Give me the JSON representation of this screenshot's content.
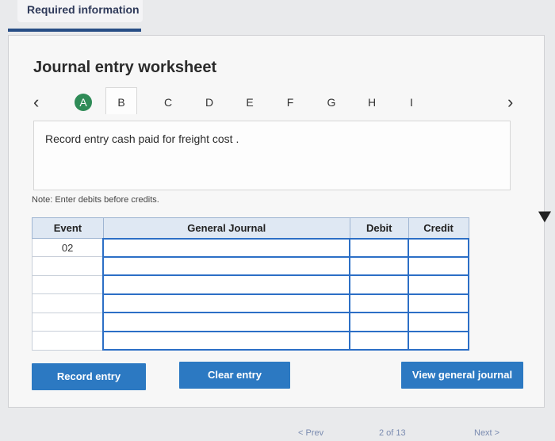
{
  "header": {
    "tab_label": "Required information"
  },
  "worksheet": {
    "title": "Journal entry worksheet",
    "nav": {
      "prev_icon": "chevron-left-icon",
      "next_icon": "chevron-right-icon",
      "steps": [
        "A",
        "B",
        "C",
        "D",
        "E",
        "F",
        "G",
        "H",
        "I"
      ],
      "active_step": "A",
      "current_tab": "B"
    },
    "instruction": "Record entry cash paid for freight cost .",
    "note": "Note: Enter debits before credits."
  },
  "journal": {
    "columns": {
      "event": "Event",
      "general_journal": "General Journal",
      "debit": "Debit",
      "credit": "Credit"
    },
    "rows": [
      {
        "event": "02",
        "account": "",
        "debit": "",
        "credit": ""
      },
      {
        "event": "",
        "account": "",
        "debit": "",
        "credit": ""
      },
      {
        "event": "",
        "account": "",
        "debit": "",
        "credit": ""
      },
      {
        "event": "",
        "account": "",
        "debit": "",
        "credit": ""
      },
      {
        "event": "",
        "account": "",
        "debit": "",
        "credit": ""
      },
      {
        "event": "",
        "account": "",
        "debit": "",
        "credit": ""
      }
    ]
  },
  "buttons": {
    "record": "Record entry",
    "clear": "Clear entry",
    "view": "View general journal"
  },
  "footer": {
    "prev": "< Prev",
    "page": "2 of 13",
    "next": "Next >"
  },
  "colors": {
    "accent": "#2c79c2",
    "active_step": "#2f8b57",
    "header_bg": "#dfe8f3"
  }
}
